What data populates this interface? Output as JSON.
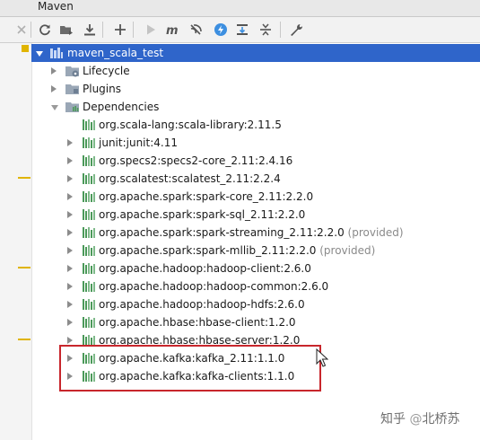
{
  "window": {
    "title": "Maven"
  },
  "toolbar": {
    "close_icon": "close-icon",
    "buttons": [
      {
        "name": "reimport-icon"
      },
      {
        "name": "generate-sources-icon"
      },
      {
        "name": "download-icon"
      },
      {
        "name": "add-icon"
      },
      {
        "name": "run-icon"
      },
      {
        "name": "execute-goal-icon"
      },
      {
        "name": "toggle-offline-icon"
      },
      {
        "name": "skip-tests-icon"
      },
      {
        "name": "show-dependencies-icon"
      },
      {
        "name": "collapse-all-icon"
      },
      {
        "name": "settings-icon"
      }
    ]
  },
  "tree": {
    "root": {
      "label": "maven_scala_test"
    },
    "lifecycle": {
      "label": "Lifecycle"
    },
    "plugins": {
      "label": "Plugins"
    },
    "dependencies": {
      "label": "Dependencies"
    },
    "deps": [
      {
        "label": "org.scala-lang:scala-library:2.11.5",
        "scope": "",
        "expandable": false
      },
      {
        "label": "junit:junit:4.11",
        "scope": "",
        "expandable": true
      },
      {
        "label": "org.specs2:specs2-core_2.11:2.4.16",
        "scope": "",
        "expandable": true
      },
      {
        "label": "org.scalatest:scalatest_2.11:2.2.4",
        "scope": "",
        "expandable": true
      },
      {
        "label": "org.apache.spark:spark-core_2.11:2.2.0",
        "scope": "",
        "expandable": true
      },
      {
        "label": "org.apache.spark:spark-sql_2.11:2.2.0",
        "scope": "",
        "expandable": true
      },
      {
        "label": "org.apache.spark:spark-streaming_2.11:2.2.0",
        "scope": "(provided)",
        "expandable": true
      },
      {
        "label": "org.apache.spark:spark-mllib_2.11:2.2.0",
        "scope": "(provided)",
        "expandable": true
      },
      {
        "label": "org.apache.hadoop:hadoop-client:2.6.0",
        "scope": "",
        "expandable": true
      },
      {
        "label": "org.apache.hadoop:hadoop-common:2.6.0",
        "scope": "",
        "expandable": true
      },
      {
        "label": "org.apache.hadoop:hadoop-hdfs:2.6.0",
        "scope": "",
        "expandable": true
      },
      {
        "label": "org.apache.hbase:hbase-client:1.2.0",
        "scope": "",
        "expandable": true
      },
      {
        "label": "org.apache.hbase:hbase-server:1.2.0",
        "scope": "",
        "expandable": true
      },
      {
        "label": "org.apache.kafka:kafka_2.11:1.1.0",
        "scope": "",
        "expandable": true
      },
      {
        "label": "org.apache.kafka:kafka-clients:1.1.0",
        "scope": "",
        "expandable": true
      }
    ]
  },
  "watermark": {
    "site": "知乎",
    "separator": "@",
    "author": "北桥苏"
  },
  "colors": {
    "selection": "#2f65ca",
    "highlight_box": "#c8262c",
    "dependency_icon_bars": "#4c9a5a",
    "gutter_mark": "#e0b400",
    "blue_accent": "#3d8fe0"
  }
}
